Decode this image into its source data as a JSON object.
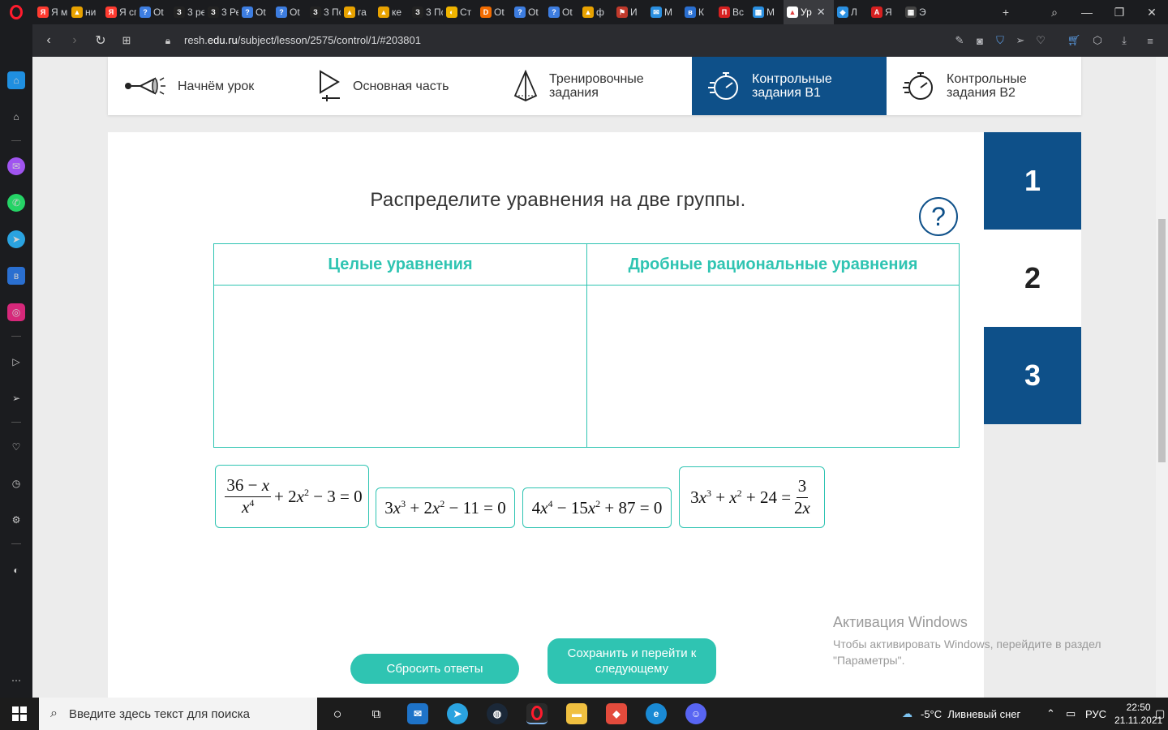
{
  "browser": {
    "tabs": [
      {
        "label": "Я м",
        "color": "#ff3b30",
        "glyph": "Я"
      },
      {
        "label": "ни",
        "color": "#e8a200",
        "glyph": "▲"
      },
      {
        "label": "Я сп",
        "color": "#ff3b30",
        "glyph": "Я"
      },
      {
        "label": "Ot",
        "color": "#3d7de0",
        "glyph": "?"
      },
      {
        "label": "3 ре",
        "color": "#222",
        "glyph": "З"
      },
      {
        "label": "3 Ре",
        "color": "#222",
        "glyph": "З"
      },
      {
        "label": "Ot",
        "color": "#3d7de0",
        "glyph": "?"
      },
      {
        "label": "Ot",
        "color": "#3d7de0",
        "glyph": "?"
      },
      {
        "label": "3 Пс",
        "color": "#222",
        "glyph": "З"
      },
      {
        "label": "га",
        "color": "#e8a200",
        "glyph": "▲"
      },
      {
        "label": "ке",
        "color": "#e8a200",
        "glyph": "▲"
      },
      {
        "label": "3 Пс",
        "color": "#222",
        "glyph": "З"
      },
      {
        "label": "Ст",
        "color": "#f0b400",
        "glyph": "◐"
      },
      {
        "label": "Ot",
        "color": "#f26b00",
        "glyph": "D"
      },
      {
        "label": "Ot",
        "color": "#3d7de0",
        "glyph": "?"
      },
      {
        "label": "Ot",
        "color": "#3d7de0",
        "glyph": "?"
      },
      {
        "label": "ф",
        "color": "#e8a200",
        "glyph": "▲"
      },
      {
        "label": "И",
        "color": "#c0392b",
        "glyph": "⚑"
      },
      {
        "label": "М",
        "color": "#2a8fe0",
        "glyph": "✉"
      },
      {
        "label": "К",
        "color": "#2a6fd0",
        "glyph": "в"
      },
      {
        "label": "Вс",
        "color": "#d62020",
        "glyph": "П"
      },
      {
        "label": "М",
        "color": "#2a8fe0",
        "glyph": "▦"
      },
      {
        "label": "Ур",
        "color": "#ffffff",
        "glyph": "▲",
        "active": true
      },
      {
        "label": "Л",
        "color": "#2a8fe0",
        "glyph": "◆"
      },
      {
        "label": "Я",
        "color": "#d62020",
        "glyph": "A"
      },
      {
        "label": "Э",
        "color": "#444",
        "glyph": "▦"
      }
    ],
    "url_prefix": "resh.",
    "url_domain": "edu.ru",
    "url_path": "/subject/lesson/2575/control/1/#203801"
  },
  "stages": [
    {
      "label": "Начнём урок"
    },
    {
      "label": "Основная часть"
    },
    {
      "label": "Тренировочные задания"
    },
    {
      "label": "Контрольные задания В1",
      "active": true
    },
    {
      "label": "Контрольные задания В2"
    }
  ],
  "side_numbers": [
    "1",
    "2",
    "3"
  ],
  "task": {
    "question": "Распределите уравнения на две группы.",
    "help": "?",
    "col_left": "Целые уравнения",
    "col_right": "Дробные рациональные уравнения",
    "equations": [
      "(36 − x)/x⁴ + 2x² − 3 = 0",
      "3x³ + 2x² − 11 = 0",
      "4x⁴ − 15x² + 87 = 0",
      "3x³ + x² + 24 = 3/(2x)"
    ],
    "reset_button": "Сбросить ответы",
    "save_button": "Сохранить и перейти к следующему"
  },
  "watermark": {
    "title": "Активация Windows",
    "body": "Чтобы активировать Windows, перейдите в раздел \"Параметры\"."
  },
  "taskbar": {
    "search_placeholder": "Введите здесь текст для поиска",
    "weather": "-5°C  Ливневый снег",
    "lang": "РУС",
    "time": "22:50",
    "date": "21.11.2021"
  },
  "colors": {
    "accent": "#2fc4b2",
    "brand": "#0e5089"
  }
}
